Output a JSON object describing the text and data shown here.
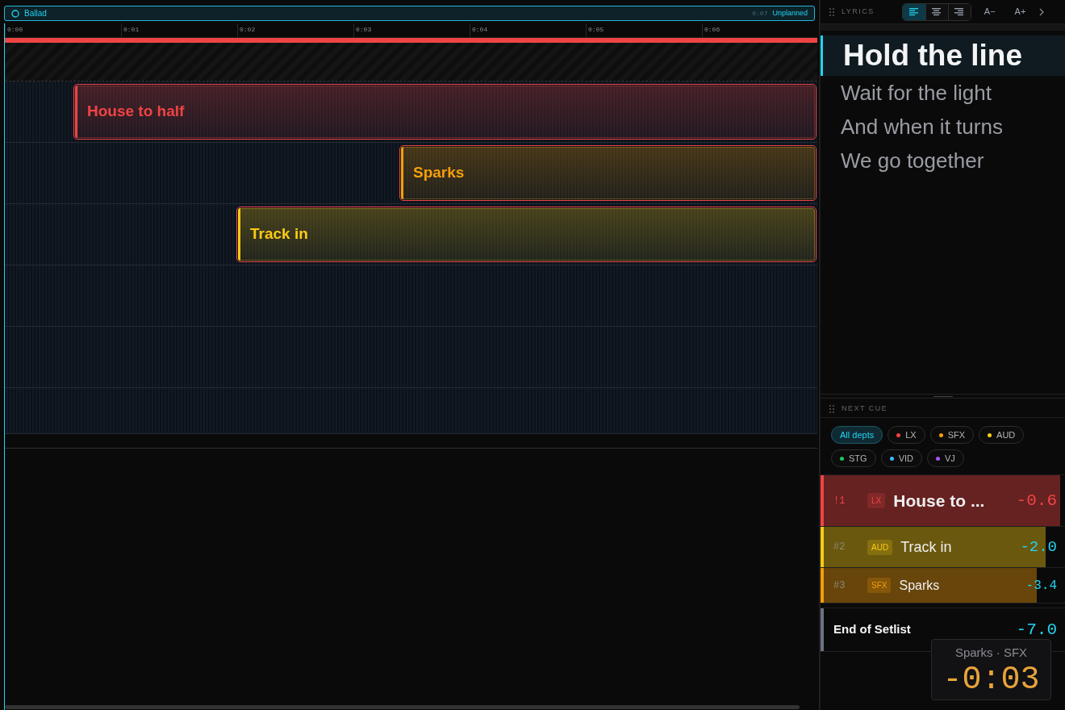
{
  "timeline": {
    "title": "Ballad",
    "time": "0:07",
    "status": "Unplanned",
    "ruler": [
      "0:00",
      "0:01",
      "0:02",
      "0:03",
      "0:04",
      "0:05",
      "0:06"
    ],
    "clips": [
      {
        "label": "House to half",
        "color": "#ef4444"
      },
      {
        "label": "Sparks",
        "color": "#f59e0b"
      },
      {
        "label": "Track in",
        "color": "#facc15"
      }
    ]
  },
  "lyrics": {
    "title": "LYRICS",
    "align_buttons": [
      {
        "selected": true
      },
      {
        "selected": false
      },
      {
        "selected": false
      }
    ],
    "font_buttons": [
      "A−",
      "A+"
    ],
    "lines": [
      {
        "text": "Hold the line",
        "selected": true
      },
      {
        "text": "Wait for the light",
        "selected": false
      },
      {
        "text": "And when it turns",
        "selected": false
      },
      {
        "text": "We go together",
        "selected": false
      }
    ]
  },
  "next_cue": {
    "title": "NEXT CUE",
    "filters": [
      {
        "label": "All depts",
        "selected": true
      },
      {
        "label": "LX",
        "color": "#ef4444",
        "selected": false
      },
      {
        "label": "SFX",
        "color": "#f59e0b",
        "selected": false
      },
      {
        "label": "AUD",
        "color": "#facc15",
        "selected": false
      },
      {
        "label": "STG",
        "color": "#22c55e",
        "selected": false
      },
      {
        "label": "VID",
        "color": "#38bdf8",
        "selected": false
      },
      {
        "label": "VJ",
        "color": "#a855f7",
        "selected": false
      }
    ],
    "cues": [
      {
        "number": "!1",
        "dept": "LX",
        "name": "House to ...",
        "time": "-0.6",
        "color": "#ef4444",
        "imminent": true,
        "level": 1
      },
      {
        "number": "#2",
        "dept": "AUD",
        "name": "Track in",
        "time": "-2.0",
        "color": "#facc15",
        "imminent": false,
        "level": 0.94
      },
      {
        "number": "#3",
        "dept": "SFX",
        "name": "Sparks",
        "time": "-3.4",
        "color": "#f59e0b",
        "imminent": false,
        "level": 0.9
      }
    ],
    "end": {
      "name": "End of Setlist",
      "time": "-7.0"
    },
    "countdown": {
      "label": "Sparks · SFX",
      "time": "-0:03"
    }
  }
}
